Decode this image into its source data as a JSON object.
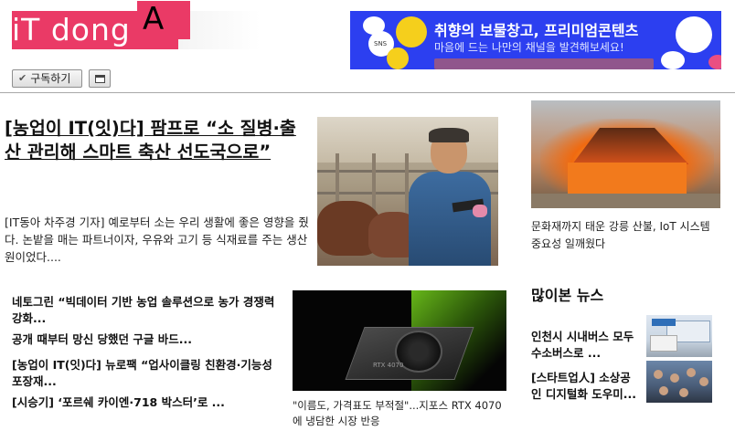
{
  "header": {
    "logo_text": "iT dong",
    "logo_accent": "A",
    "ad": {
      "line1": "취향의 보물창고, 프리미엄콘텐츠",
      "line2": "마음에 드는 나만의 채널을 발견해보세요!",
      "badge_text": "SNS"
    }
  },
  "toolbar": {
    "subscribe_label": "구독하기"
  },
  "main_story": {
    "headline": "[농업이 IT(잇)다] 팜프로 “소 질병·출산 관리해 스마트 축산 선도국으로”",
    "summary": "[IT동아 차주경 기자] 예로부터 소는 우리 생활에 좋은 영향을 줬다. 논밭을 매는 파트너이자, 우유와 고기 등 식재료를 주는 생산원이었다...."
  },
  "story_list": [
    "네토그린 “빅데이터 기반 농업 솔루션으로 농가 경쟁력 강화...",
    "공개 때부터 망신 당했던 구글 바드...",
    "[농업이 IT(잇)다] 뉴로팩 “업사이클링 친환경·기능성 포장재...",
    "[시승기] ‘포르쉐 카이엔·718 박스터’로 ..."
  ],
  "gpu_story": {
    "caption": "\"이름도, 가격표도 부적절\"...지포스 RTX 4070에 냉담한 시장 반응",
    "gpu_label": "RTX 4070"
  },
  "right_column": {
    "fire_caption": "문화재까지 태운 강릉 산불, IoT 시스템 중요성 일깨웠다",
    "popular_title": "많이본 뉴스",
    "popular_items": [
      "인천시 시내버스 모두 수소버스로 ...",
      "[스타트업人] 소상공인 디지털화 도우미..."
    ]
  }
}
